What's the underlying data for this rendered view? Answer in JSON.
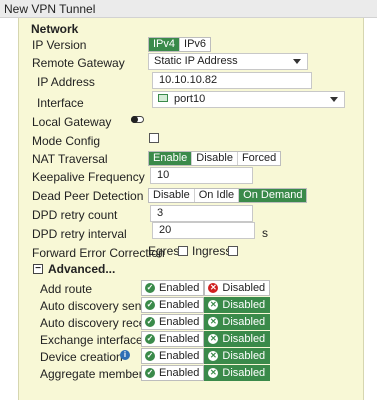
{
  "window": {
    "title": "New VPN Tunnel"
  },
  "section": {
    "title": "Network"
  },
  "ip_version": {
    "label": "IP Version",
    "options": [
      "IPv4",
      "IPv6"
    ],
    "selected": "IPv4"
  },
  "remote_gateway": {
    "label": "Remote Gateway",
    "value": "Static IP Address"
  },
  "ip_address": {
    "label": "IP Address",
    "value": "10.10.10.82"
  },
  "interface": {
    "label": "Interface",
    "value": "port10"
  },
  "local_gateway": {
    "label": "Local Gateway"
  },
  "mode_config": {
    "label": "Mode Config"
  },
  "nat_traversal": {
    "label": "NAT Traversal",
    "options": [
      "Enable",
      "Disable",
      "Forced"
    ],
    "selected": "Enable"
  },
  "keepalive": {
    "label": "Keepalive Frequency",
    "value": "10"
  },
  "dpd": {
    "label": "Dead Peer Detection",
    "options": [
      "Disable",
      "On Idle",
      "On Demand"
    ],
    "selected": "On Demand"
  },
  "dpd_retry_count": {
    "label": "DPD retry count",
    "value": "3"
  },
  "dpd_retry_interval": {
    "label": "DPD retry interval",
    "value": "20",
    "unit": "s"
  },
  "fec": {
    "label": "Forward Error Correction",
    "egress": "Egress",
    "ingress": "Ingress"
  },
  "advanced": {
    "label": "Advanced..."
  },
  "toggle_labels": {
    "enabled": "Enabled",
    "disabled": "Disabled"
  },
  "advanced_rows": [
    {
      "label": "Add route",
      "state": "enabled"
    },
    {
      "label": "Auto discovery sender",
      "state": "disabled"
    },
    {
      "label": "Auto discovery receiver",
      "state": "disabled"
    },
    {
      "label": "Exchange interface IP",
      "state": "disabled"
    },
    {
      "label": "Device creation",
      "state": "disabled"
    },
    {
      "label": "Aggregate member",
      "state": "disabled"
    }
  ],
  "colors": {
    "accent_green": "#3a8a4a",
    "panel_bg": "#f8f8d6",
    "disabled_red": "#d02020",
    "info_blue": "#2f6fb5"
  },
  "icons": {
    "info": "info-icon",
    "check": "check-circle-icon",
    "x": "x-circle-icon"
  }
}
